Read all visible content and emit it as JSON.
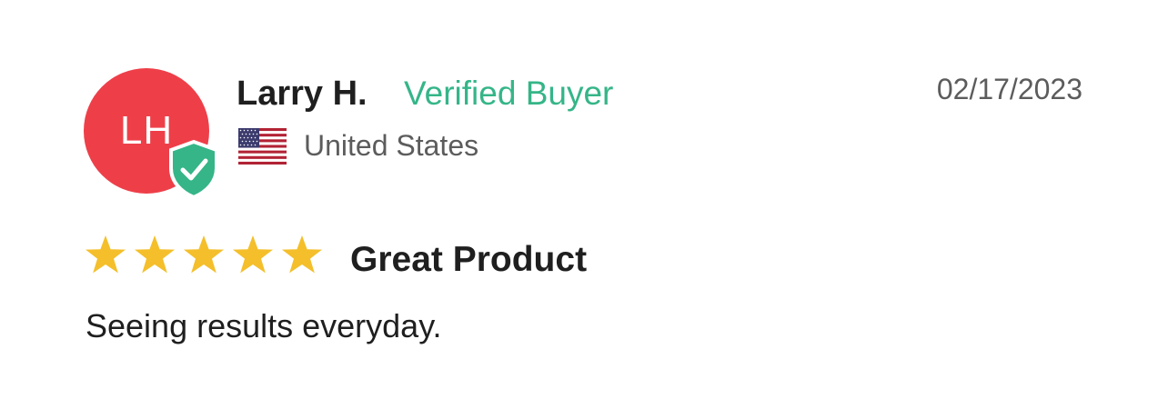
{
  "review": {
    "avatar": {
      "initials": "LH",
      "color": "#ee3f49",
      "badge_icon": "verified-shield-check-icon",
      "badge_color": "#35b588"
    },
    "reviewer_name": "Larry H.",
    "verified_label": "Verified Buyer",
    "date": "02/17/2023",
    "location": {
      "flag_icon": "us-flag-icon",
      "country": "United States"
    },
    "rating": {
      "value": 5,
      "max": 5,
      "star_color": "#f4bf2b"
    },
    "title": "Great Product",
    "body": "Seeing results everyday."
  }
}
